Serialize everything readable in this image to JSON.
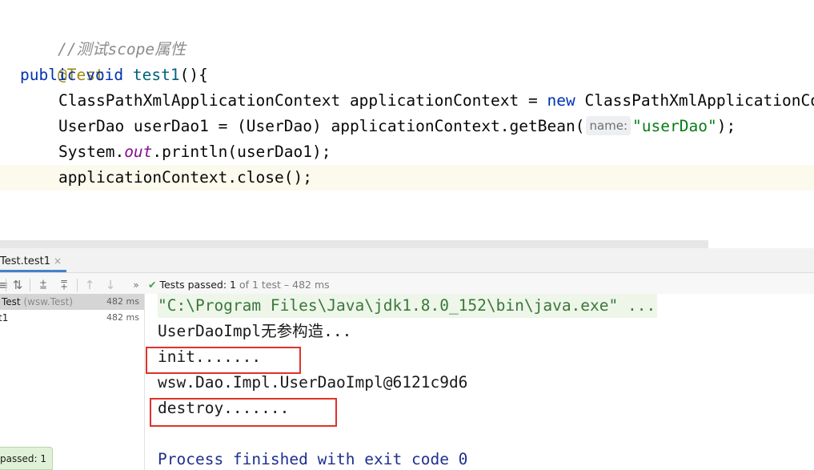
{
  "editor": {
    "comment": "//测试scope属性",
    "annotation": "@Test",
    "method_kw_public": "public",
    "method_kw_void": "void",
    "method_name": "test1",
    "method_open": "(){",
    "line_ctx_type": "ClassPathXmlApplicationContext",
    "line_ctx_rest": " applicationContext = ",
    "line_ctx_new": "new",
    "line_ctx_tail": " ClassPathXmlApplicationContext(",
    "line_get_pre": "UserDao userDao1 = (UserDao) applicationContext.getBean(",
    "line_get_hint": "name:",
    "line_get_str": "\"userDao\"",
    "line_get_post": ");",
    "line_print_pre": "System.",
    "line_print_static": "out",
    "line_print_post": ".println(userDao1);",
    "line_close": "applicationContext.close();",
    "closing_brace": "}"
  },
  "run": {
    "tab_label": "Test.test1",
    "tab_close": "×",
    "summary_prefix": "Tests passed:",
    "summary_count": "1",
    "summary_suffix": "of 1 test – 482 ms",
    "tree": [
      {
        "label": "Test",
        "sub": "(wsw.Test)",
        "time": "482 ms"
      },
      {
        "label": "t1",
        "sub": "",
        "time": "482 ms"
      }
    ],
    "console": [
      "\"C:\\Program Files\\Java\\jdk1.8.0_152\\bin\\java.exe\" ...",
      "UserDaoImpl无参构造...",
      "init.......",
      "wsw.Dao.Impl.UserDaoImpl@6121c9d6",
      "destroy.......",
      "Process finished with exit code 0"
    ],
    "toast": "passed: 1"
  },
  "colors": {
    "keyword": "#0033b3",
    "string": "#067d17",
    "annotation": "#9e880d",
    "highlight_box": "#e0312a",
    "pass_green": "#4a9f4a"
  }
}
